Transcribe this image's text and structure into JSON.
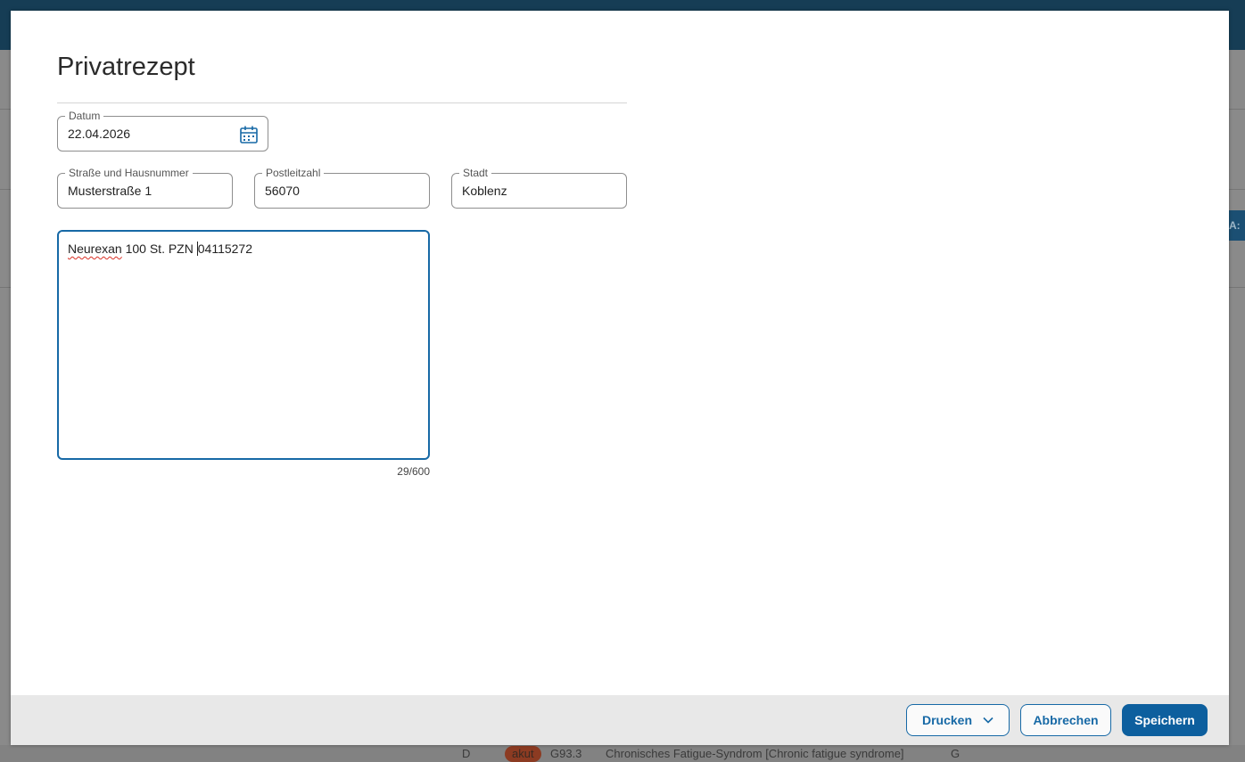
{
  "dialog": {
    "title": "Privatrezept"
  },
  "fields": {
    "datum": {
      "label": "Datum",
      "value": "22.04.2026"
    },
    "strasse": {
      "label": "Straße und Hausnummer",
      "value": "Musterstraße 1"
    },
    "plz": {
      "label": "Postleitzahl",
      "value": "56070"
    },
    "stadt": {
      "label": "Stadt",
      "value": "Koblenz"
    }
  },
  "prescription": {
    "text_misspelled": "Neurexan",
    "text_before_caret": " 100 St. PZN ",
    "text_after_caret": "04115272",
    "char_count": "29/600"
  },
  "footer": {
    "print_label": "Drucken",
    "cancel_label": "Abbrechen",
    "save_label": "Speichern"
  },
  "background": {
    "side_button_text": "A:",
    "row": {
      "col1": "D",
      "chip": "akut",
      "code": "G93.3",
      "diagnosis": "Chronisches Fatigue-Syndrom [Chronic fatigue syndrome]",
      "col_last": "G"
    }
  },
  "icons": {
    "calendar": "calendar-icon",
    "print_dropdown": "chevron-down-icon"
  },
  "colors": {
    "accent": "#1769a6",
    "primary_button": "#0d5f9e",
    "footer_bg": "#e8e8e8",
    "topbar": "#163d55"
  }
}
